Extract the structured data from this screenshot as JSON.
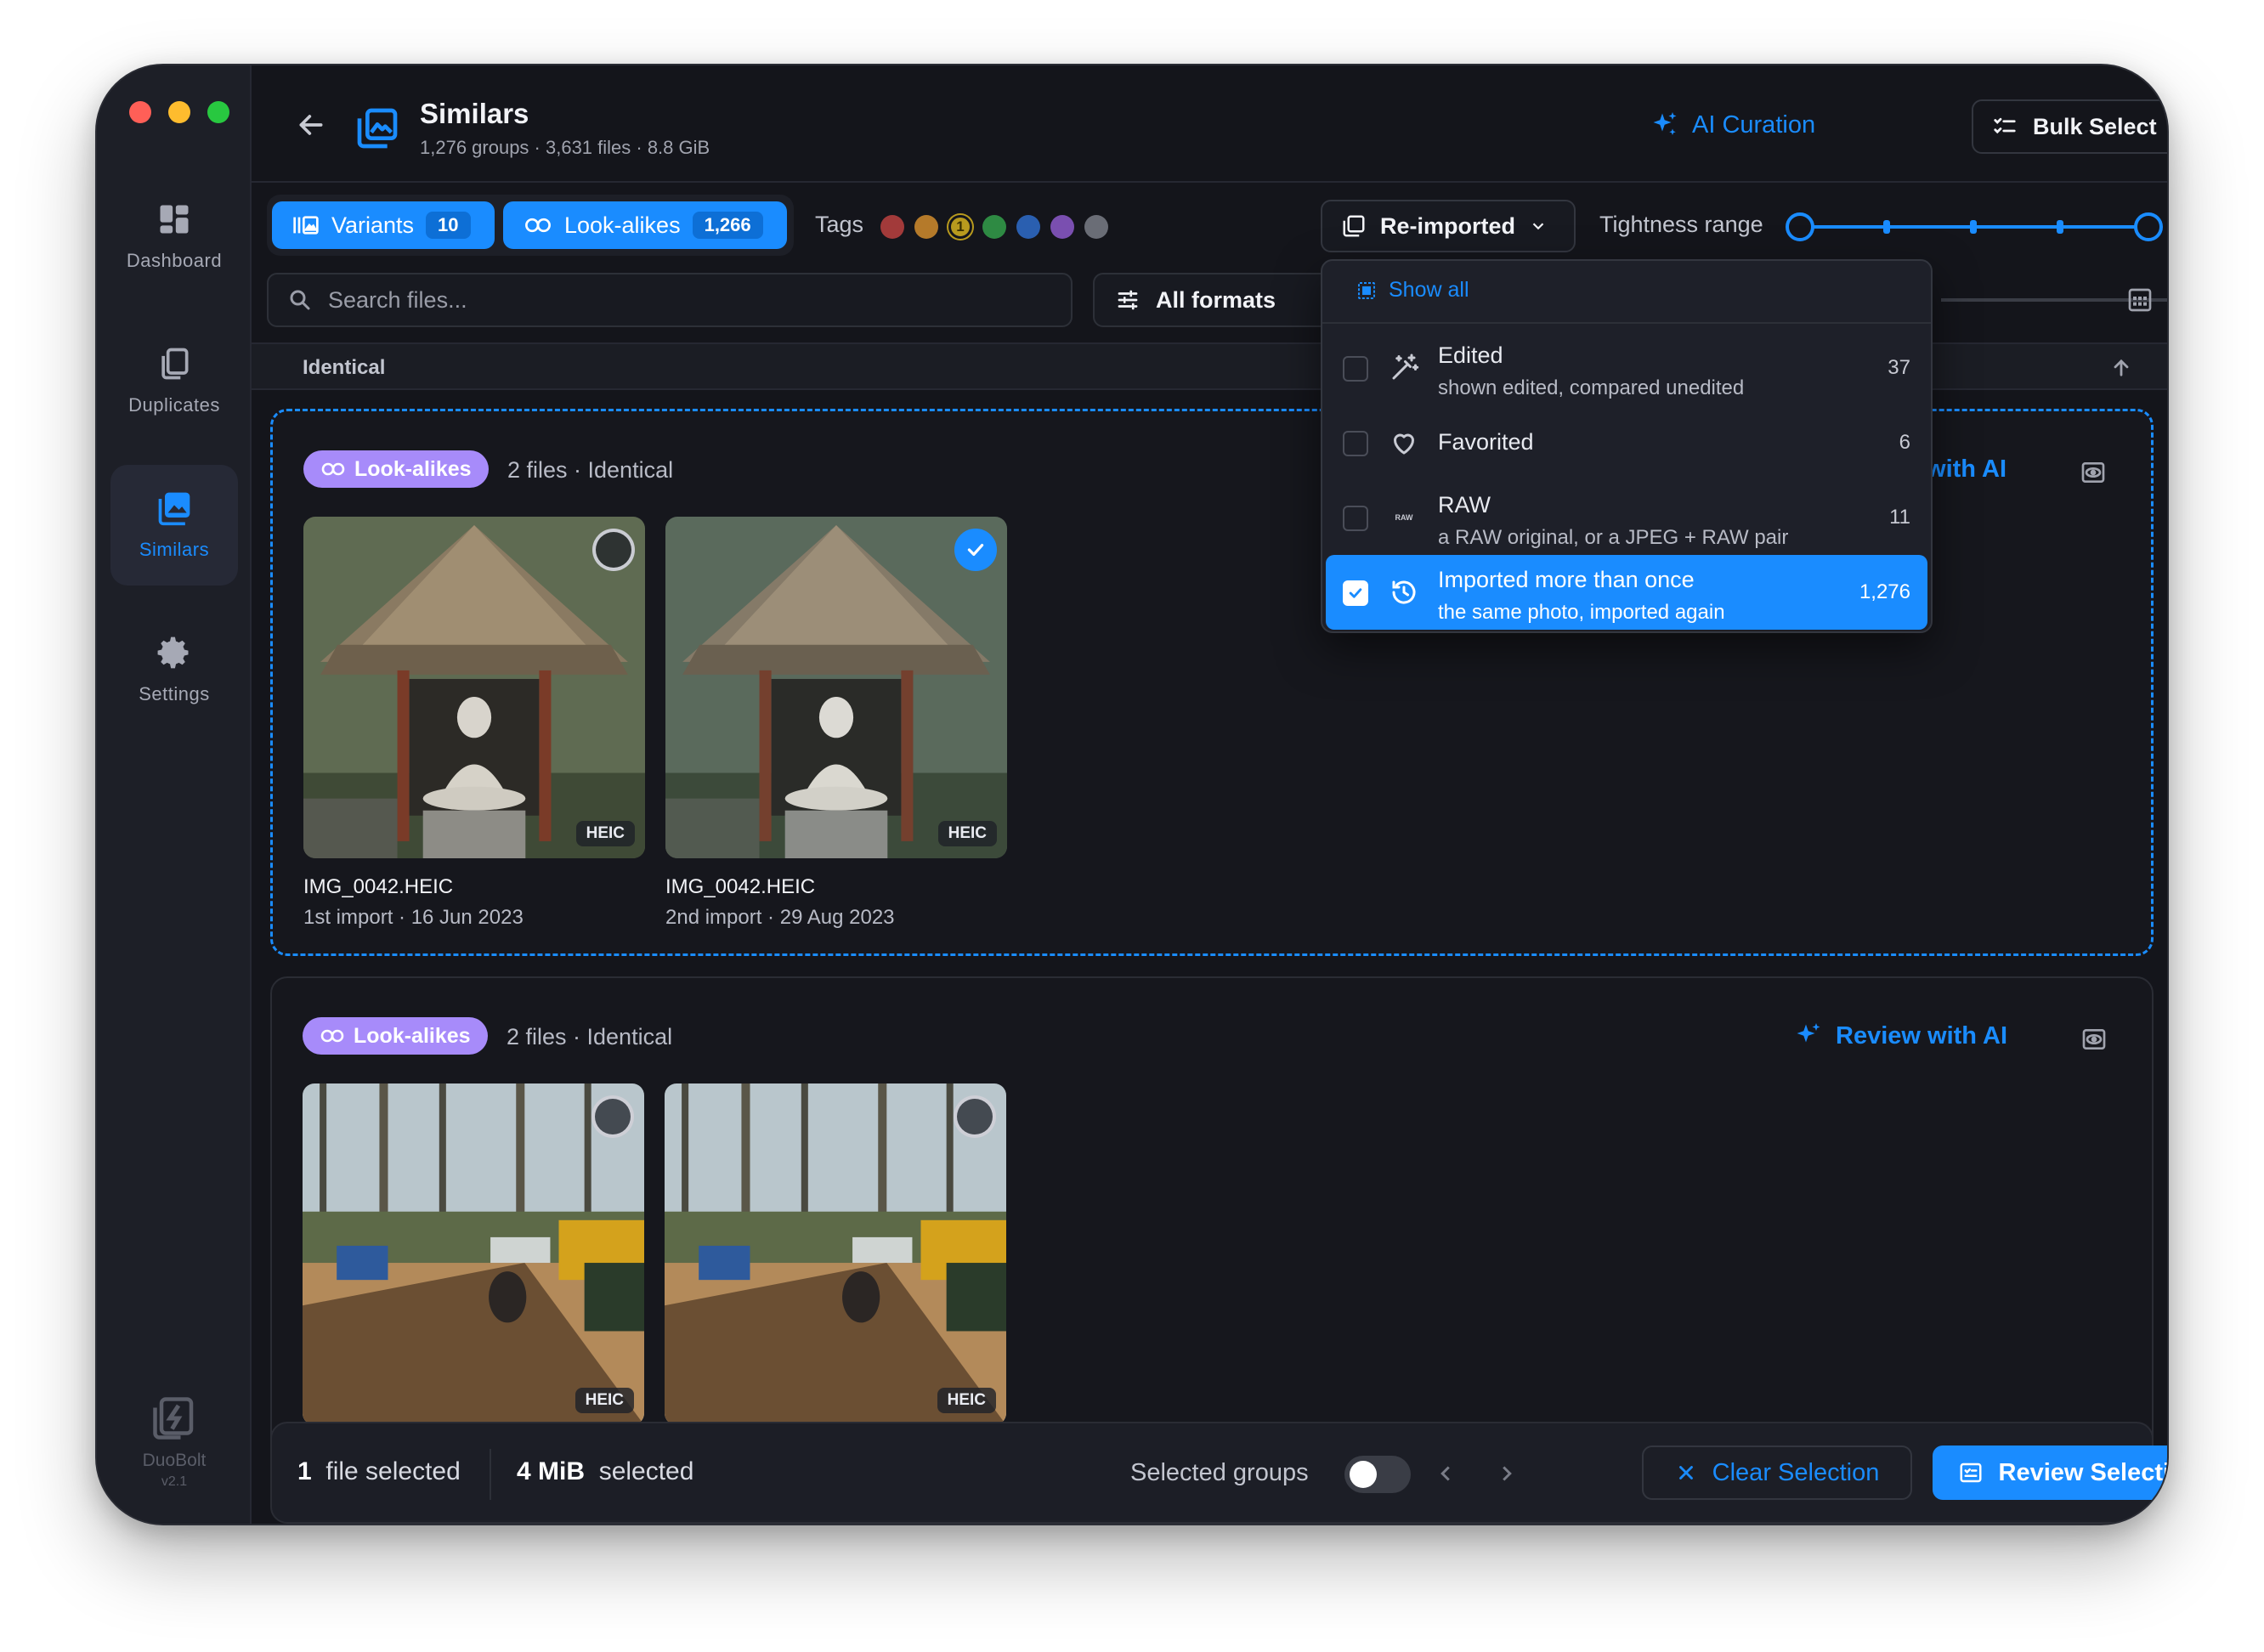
{
  "window": {
    "traffic_colors": [
      "#ff5f57",
      "#febc2e",
      "#28c840"
    ]
  },
  "sidebar": {
    "items": [
      {
        "label": "Dashboard",
        "icon": "dashboard-icon"
      },
      {
        "label": "Duplicates",
        "icon": "duplicates-icon"
      },
      {
        "label": "Similars",
        "icon": "similars-icon",
        "active": true
      },
      {
        "label": "Settings",
        "icon": "gear-icon"
      }
    ],
    "brand": {
      "name": "DuoBolt",
      "version": "v2.1"
    }
  },
  "header": {
    "title": "Similars",
    "subtitle": "1,276 groups · 3,631 files · 8.8 GiB",
    "ai_curation": "AI Curation",
    "bulk_select": "Bulk Select"
  },
  "toolbar": {
    "variants": {
      "label": "Variants",
      "count": "10"
    },
    "lookalikes": {
      "label": "Look-alikes",
      "count": "1,266"
    },
    "tags_label": "Tags",
    "tag_colors": [
      "#a23a3a",
      "#b57a2a",
      "#b89a1e",
      "#2e8a43",
      "#2a5fb0",
      "#7a4fb0",
      "#6a6d76"
    ],
    "tag_badge": "1",
    "reimported": "Re-imported",
    "tightness_label": "Tightness range",
    "tightness_range": [
      0,
      1
    ],
    "search_placeholder": "Search files...",
    "formats": "All formats"
  },
  "section": {
    "label": "Identical"
  },
  "dropdown": {
    "show_all": "Show all",
    "items": [
      {
        "title": "Edited",
        "sub": "shown edited, compared unedited",
        "count": "37",
        "checked": false,
        "icon": "magic-wand-icon"
      },
      {
        "title": "Favorited",
        "sub": "",
        "count": "6",
        "checked": false,
        "icon": "heart-icon"
      },
      {
        "title": "RAW",
        "sub": "a RAW original, or a JPEG + RAW pair",
        "count": "11",
        "checked": false,
        "icon": "raw-icon",
        "icon_text": "RAW"
      },
      {
        "title": "Imported more than once",
        "sub": "the same photo, imported again",
        "count": "1,276",
        "checked": true,
        "icon": "history-icon"
      }
    ]
  },
  "groups": [
    {
      "pill": "Look-alikes",
      "info": "2 files · Identical",
      "review": "Review with AI",
      "files": [
        {
          "name": "IMG_0042.HEIC",
          "meta": "1st import · 16 Jun 2023",
          "format": "HEIC",
          "selected": false
        },
        {
          "name": "IMG_0042.HEIC",
          "meta": "2nd import · 29 Aug 2023",
          "format": "HEIC",
          "selected": true
        }
      ]
    },
    {
      "pill": "Look-alikes",
      "info": "2 files · Identical",
      "review": "Review with AI",
      "files": [
        {
          "format": "HEIC",
          "selected": false
        },
        {
          "format": "HEIC",
          "selected": false
        }
      ]
    }
  ],
  "bottom": {
    "files_count": "1",
    "files_label": "file selected",
    "size_value": "4 MiB",
    "size_label": "selected",
    "selected_groups": "Selected groups",
    "selected_groups_on": false,
    "clear": "Clear Selection",
    "review": "Review Selection"
  }
}
